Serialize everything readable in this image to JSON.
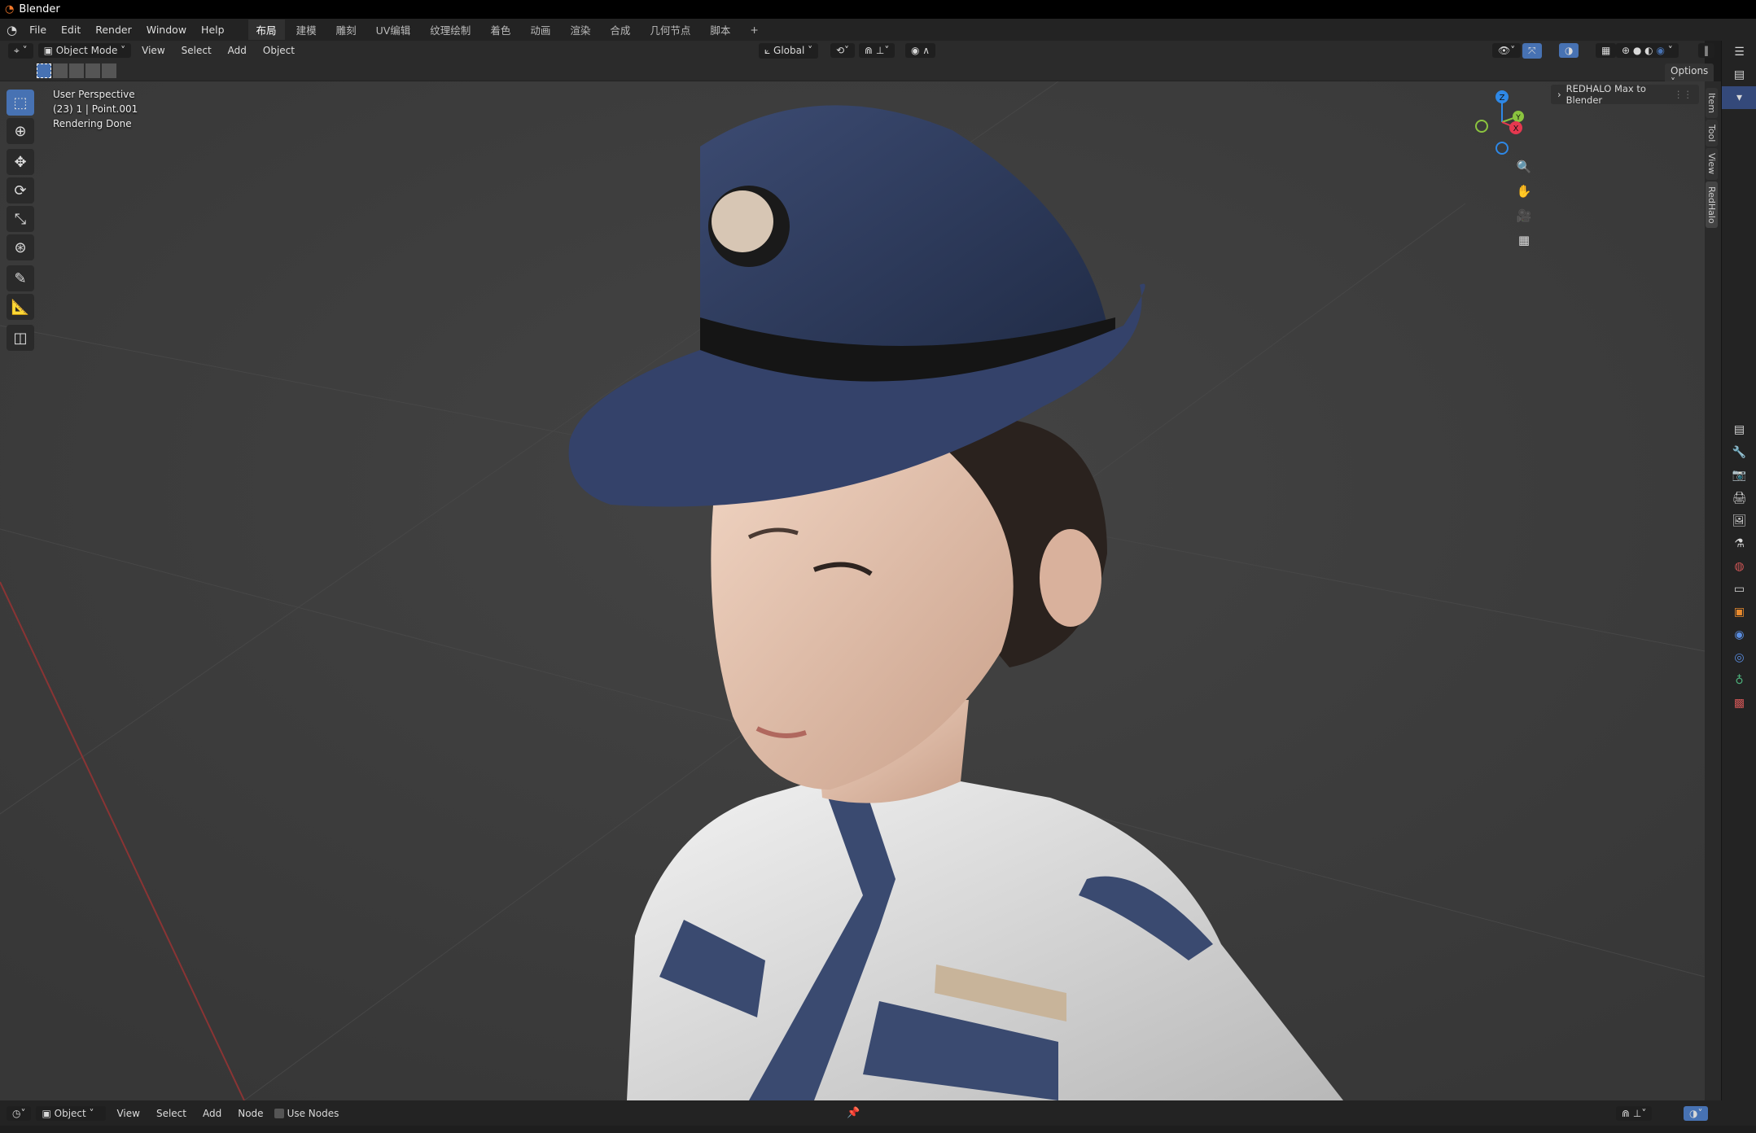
{
  "app": {
    "title": "Blender"
  },
  "menu": {
    "items": [
      "File",
      "Edit",
      "Render",
      "Window",
      "Help"
    ],
    "workspaces": [
      "布局",
      "建模",
      "雕刻",
      "UV编辑",
      "纹理绘制",
      "着色",
      "动画",
      "渲染",
      "合成",
      "几何节点",
      "脚本"
    ],
    "add_workspace": "+"
  },
  "header": {
    "mode": "Object Mode",
    "items": [
      "View",
      "Select",
      "Add",
      "Object"
    ],
    "transform_orientation": "Global",
    "options": "Options"
  },
  "viewport": {
    "perspective": "User Perspective",
    "object_info": "(23) 1 | Point.001",
    "status": "Rendering Done",
    "panel_title": "REDHALO Max to Blender",
    "axes": [
      "X",
      "Y",
      "Z"
    ]
  },
  "sidebar_tabs": [
    "Item",
    "Tool",
    "View",
    "RedHalo"
  ],
  "bottom": {
    "editor_mode": "Object",
    "items": [
      "View",
      "Select",
      "Add",
      "Node"
    ],
    "use_nodes": "Use Nodes"
  },
  "colors": {
    "accent": "#4772b3",
    "viewport": "#3d3d3d",
    "x_axis": "#e5384f",
    "y_axis": "#8bc43f",
    "z_axis": "#2e88e6"
  }
}
